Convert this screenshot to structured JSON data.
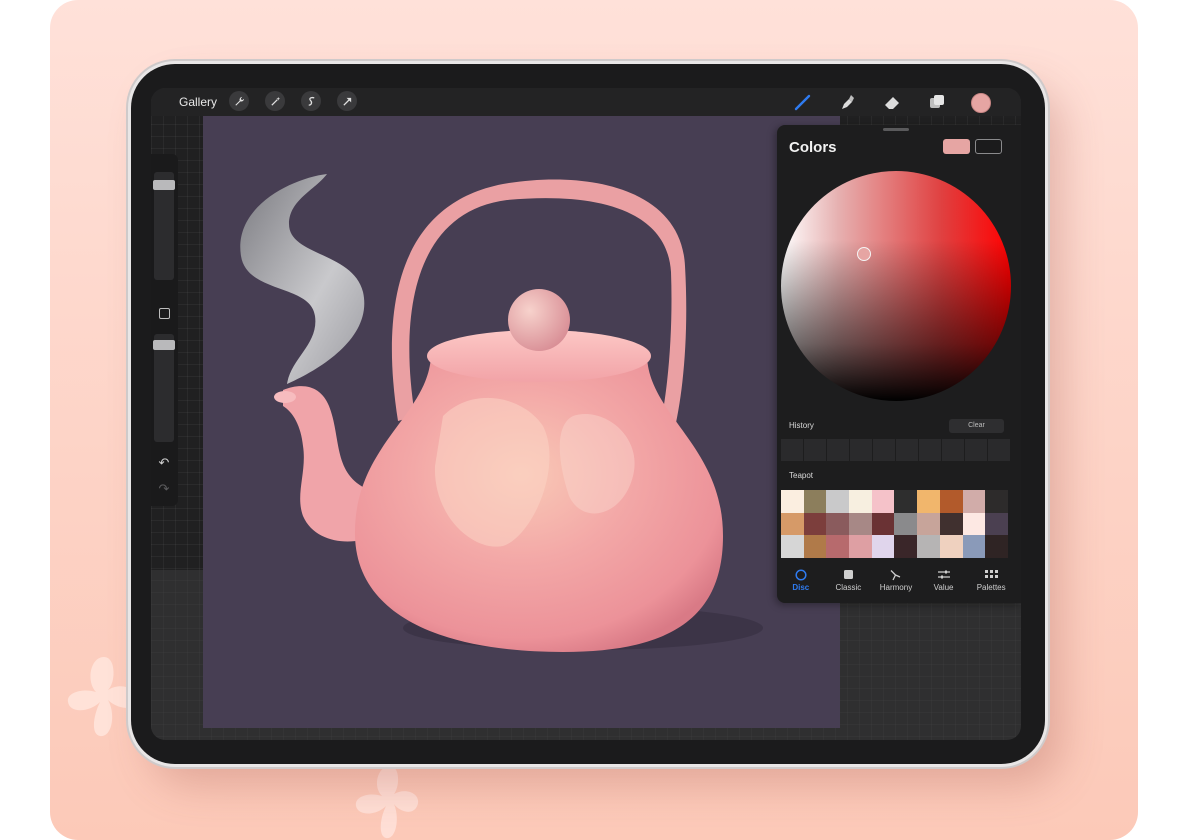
{
  "topbar": {
    "gallery_label": "Gallery",
    "left_tools": [
      "wrench-icon",
      "magic-wand-icon",
      "selection-icon",
      "transform-arrow-icon"
    ],
    "right_tools": [
      "brush-icon",
      "smudge-icon",
      "eraser-icon",
      "layers-icon"
    ],
    "current_color": "#e6a5a3"
  },
  "colors_panel": {
    "title": "Colors",
    "primary_color": "#e6a5a3",
    "secondary_color": "#1b1b1c",
    "history_label": "History",
    "clear_label": "Clear",
    "palette_name": "Teapot",
    "palette": [
      "#fbeee0",
      "#8c7e5c",
      "#c9c9ca",
      "#f7efe0",
      "#f5c2c9",
      "#2e2e2e",
      "#f1b66c",
      "#b25a2b",
      "#d1aca9",
      "#2d2b2b",
      "#d69a68",
      "#7c3e3c",
      "#8a5b5d",
      "#a78886",
      "#6a3234",
      "#8a8a8c",
      "#c7a49a",
      "#40302f",
      "#fde8e3",
      "#4b4051",
      "#d6d6d6",
      "#b07a49",
      "#b76a6d",
      "#de9fa3",
      "#e0d5ec",
      "#3a2629",
      "#b6b4b4",
      "#efd1bf",
      "#8a9ab9",
      "#2f2424"
    ],
    "tabs": [
      {
        "label": "Disc",
        "icon": "disc-icon"
      },
      {
        "label": "Classic",
        "icon": "classic-icon"
      },
      {
        "label": "Harmony",
        "icon": "harmony-icon"
      },
      {
        "label": "Value",
        "icon": "value-sliders-icon"
      },
      {
        "label": "Palettes",
        "icon": "palettes-grid-icon"
      }
    ],
    "active_tab": "Disc"
  },
  "canvas": {
    "background_color": "#473e53",
    "artwork": "pink-teapot-illustration"
  }
}
